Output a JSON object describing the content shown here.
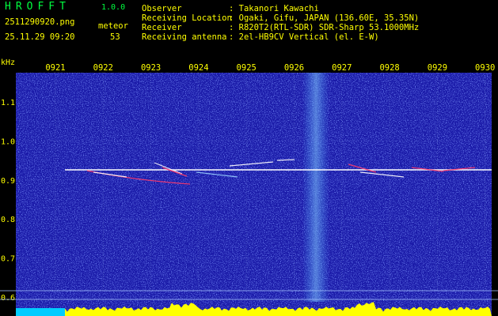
{
  "app": {
    "title": "HROFFT",
    "version": "1.0.0"
  },
  "file": {
    "name": "2511290920.png",
    "datetime": "25.11.29 09:20"
  },
  "meteor": {
    "label": "meteor",
    "count": "53"
  },
  "info": [
    {
      "key": "Observer",
      "value": ": Takanori Kawachi"
    },
    {
      "key": "Receiving Location",
      "value": ": Ogaki, Gifu, JAPAN (136.60E, 35.35N)"
    },
    {
      "key": "Receiver",
      "value": ": R820T2(RTL-SDR) SDR-Sharp 53.1000MHz"
    },
    {
      "key": "Receiving antenna",
      "value": ": 2el-HB9CV Vertical (el. E-W)"
    }
  ],
  "spectrogram": {
    "unit": "kHz",
    "time_ticks": [
      "0921",
      "0922",
      "0923",
      "0924",
      "0925",
      "0926",
      "0927",
      "0928",
      "0929",
      "0930"
    ],
    "freq_ticks": [
      "1.1",
      "1.0",
      "0.9",
      "0.8",
      "0.7",
      "0.6"
    ],
    "colors": {
      "label": "#ffff00",
      "title": "#00ff40",
      "background": "#1a1aa8",
      "signal": "#ffffff",
      "meteor": "#ff3b6b",
      "level": "#ffff00",
      "level_left": "#00ccff"
    }
  }
}
